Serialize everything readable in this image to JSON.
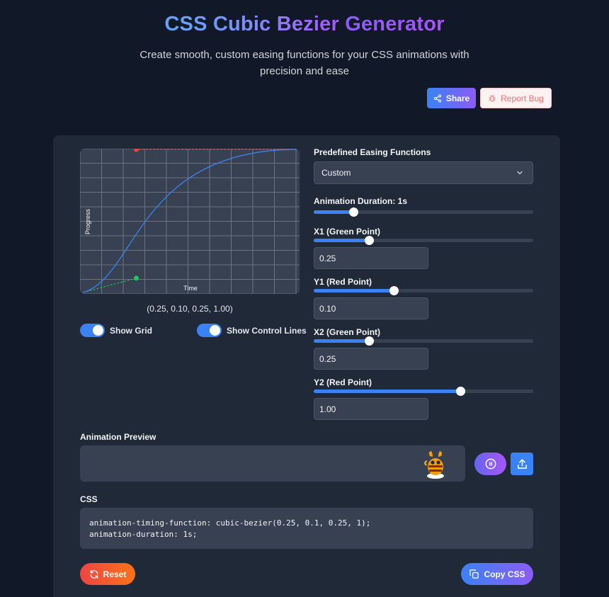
{
  "header": {
    "title_part1": "CSS Cubic Bezier",
    "title_part2": "Generator",
    "subtitle": "Create smooth, custom easing functions for your CSS animations with precision and ease",
    "share_label": "Share",
    "report_bug_label": "Report Bug"
  },
  "curve": {
    "x_axis_label": "Time",
    "y_axis_label": "Progress",
    "coords_text": "(0.25, 0.10, 0.25, 1.00)",
    "p1": [
      0.25,
      0.1
    ],
    "p2": [
      0.25,
      1.0
    ],
    "colors": {
      "curve": "#3b82f6",
      "p1": "#22c55e",
      "p2": "#ef4444",
      "grid": "#6b7280"
    }
  },
  "toggles": {
    "show_grid_label": "Show Grid",
    "show_grid_on": true,
    "show_control_lines_label": "Show Control Lines",
    "show_control_lines_on": true
  },
  "controls": {
    "preset_label": "Predefined Easing Functions",
    "preset_value": "Custom",
    "duration_label": "Animation Duration: 1s",
    "duration_fraction": 0.18,
    "x1_label": "X1 (Green Point)",
    "x1_value": "0.25",
    "x1_fraction": 0.25,
    "y1_label": "Y1 (Red Point)",
    "y1_value": "0.10",
    "y1_fraction": 0.366,
    "x2_label": "X2 (Green Point)",
    "x2_value": "0.25",
    "x2_fraction": 0.25,
    "y2_label": "Y2 (Red Point)",
    "y2_value": "1.00",
    "y2_fraction": 0.667
  },
  "preview": {
    "label": "Animation Preview"
  },
  "css": {
    "label": "CSS",
    "line1": "animation-timing-function: cubic-bezier(0.25, 0.1, 0.25, 1);",
    "line2": "animation-duration: 1s;"
  },
  "actions": {
    "reset_label": "Reset",
    "copy_label": "Copy CSS"
  }
}
